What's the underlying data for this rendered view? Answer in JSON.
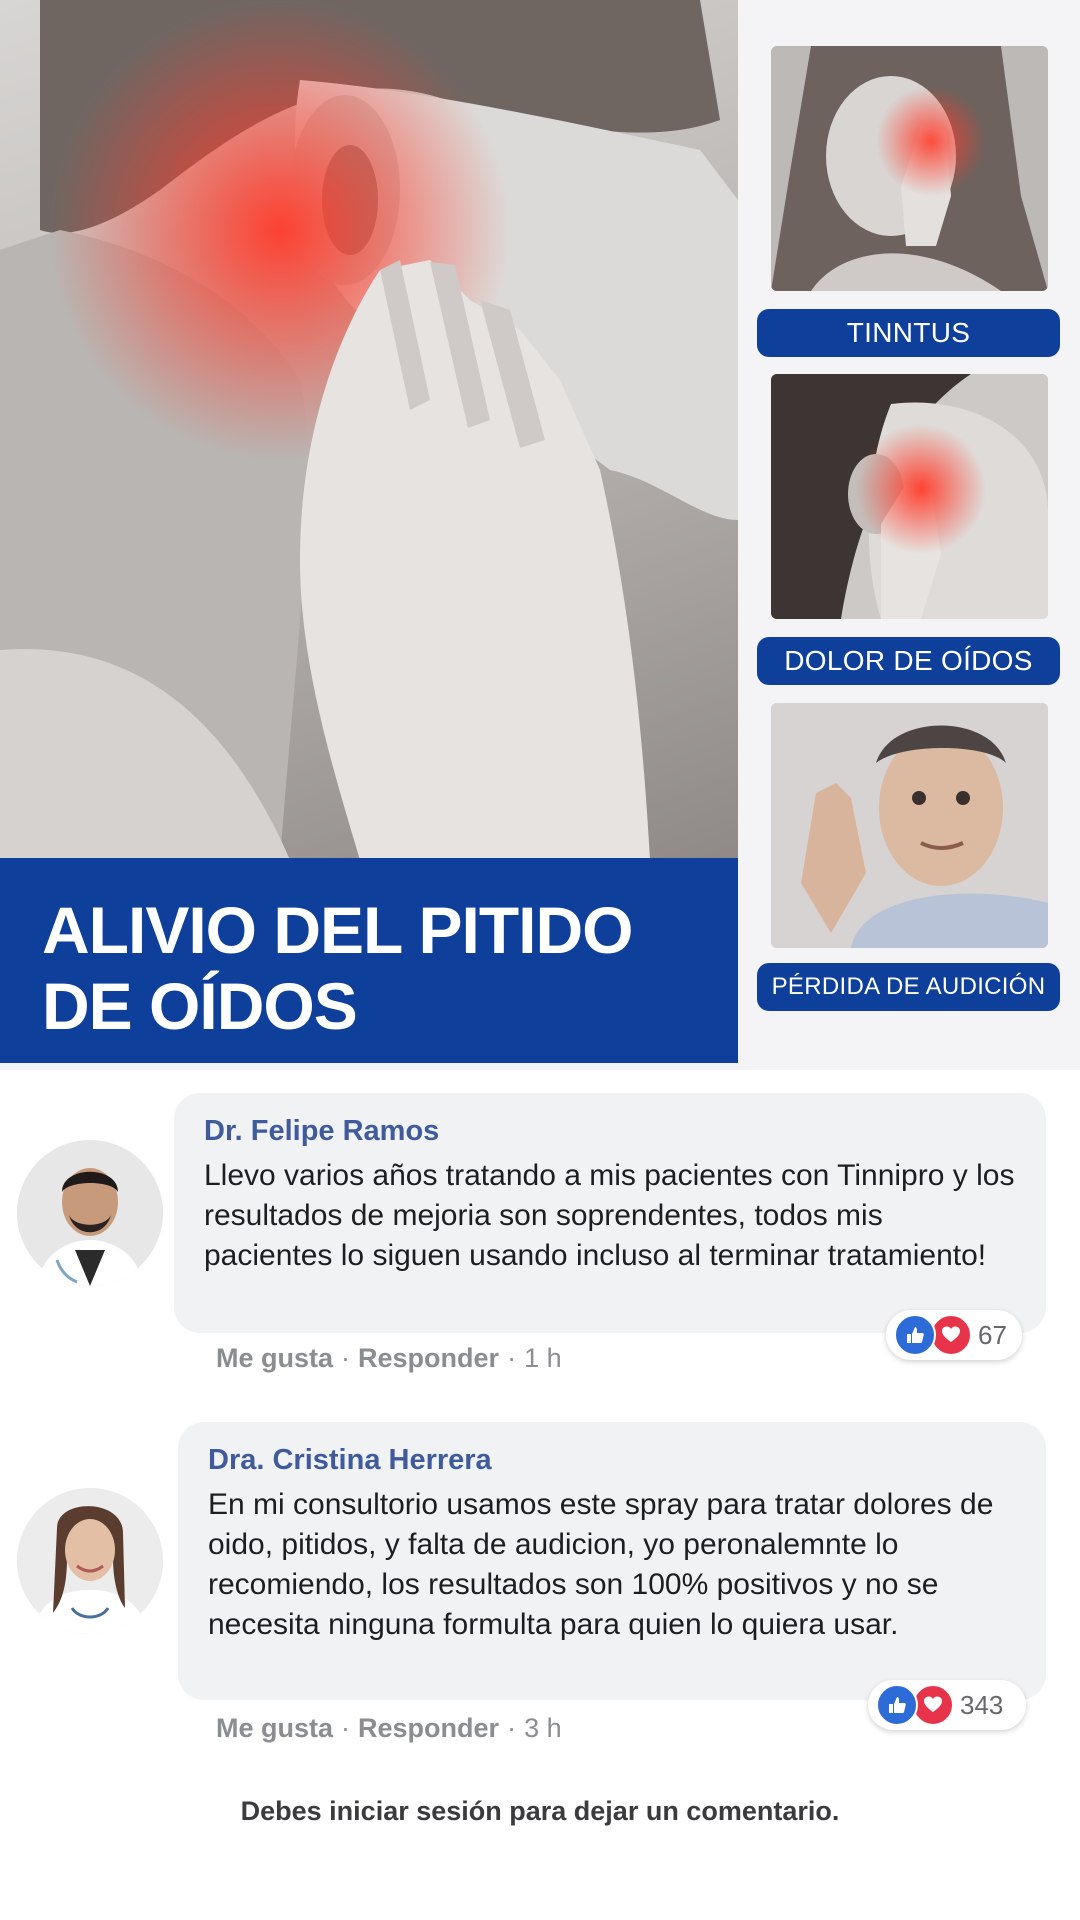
{
  "banner": {
    "title_line1": "ALIVIO DEL PITIDO",
    "title_line2": "DE OÍDOS",
    "labels": [
      "TINNTUS",
      "DOLOR DE OÍDOS",
      "PÉRDIDA DE AUDICIÓN"
    ],
    "colors": {
      "brand_blue": "#0e3f9b",
      "pain_red": "#ff3b2a"
    }
  },
  "comments": [
    {
      "author": "Dr. Felipe Ramos",
      "text": "Llevo varios años tratando a mis pacientes con Tinnipro y los resultados de mejoria son soprendentes, todos mis pacientes lo siguen usando incluso al terminar tratamiento!",
      "reaction_count": "67",
      "like_label": "Me gusta",
      "reply_label": "Responder",
      "time": "1 h",
      "reaction_icons": [
        "like-icon",
        "love-icon"
      ]
    },
    {
      "author": "Dra. Cristina Herrera",
      "text": "En mi consultorio usamos este spray para tratar dolores de oido, pitidos, y falta de audicion, yo peronalemnte lo recomiendo, los resultados son 100% positivos y no se necesita ninguna formulta para quien lo quiera usar.",
      "reaction_count": "343",
      "like_label": "Me gusta",
      "reply_label": "Responder",
      "time": "3 h",
      "reaction_icons": [
        "like-icon",
        "love-icon"
      ]
    }
  ],
  "login_note": "Debes iniciar sesión para dejar un comentario."
}
